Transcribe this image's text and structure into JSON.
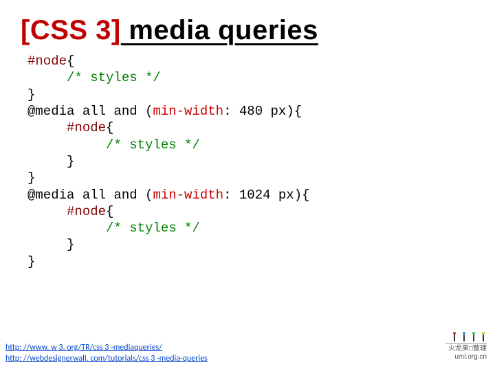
{
  "title": {
    "prefix": "[CSS 3]",
    "suffix": " media queries"
  },
  "code": {
    "l1_sel": "#node",
    "l1_open": "{",
    "l2_comment": "/* styles */",
    "l3_close": "}",
    "l4_at": "@media",
    "l4_kw": " all and ",
    "l4_po": "(",
    "l4_prop": "min-width",
    "l4_colon": ":",
    "l4_val": " 480 px",
    "l4_pc": ")",
    "l4_ob": "{",
    "l5_sel": "#node",
    "l5_open": "{",
    "l6_comment": "/* styles */",
    "l7_close": "}",
    "l8_close": "}",
    "l9_at": "@media",
    "l9_kw": " all and ",
    "l9_po": "(",
    "l9_prop": "min-width",
    "l9_colon": ":",
    "l9_val": " 1024 px",
    "l9_pc": ")",
    "l9_ob": "{",
    "l10_sel": "#node",
    "l10_open": "{",
    "l11_comment": "/* styles */",
    "l12_close": "}",
    "l13_close": "}"
  },
  "links": [
    "http: //www. w 3. org/TR/css 3 -mediaqueries/",
    "http: //webdesignerwall. com/tutorials/css 3 -media-queries"
  ],
  "branding": {
    "line1": "火龙果□整理",
    "line2": "uml.org.cn"
  }
}
